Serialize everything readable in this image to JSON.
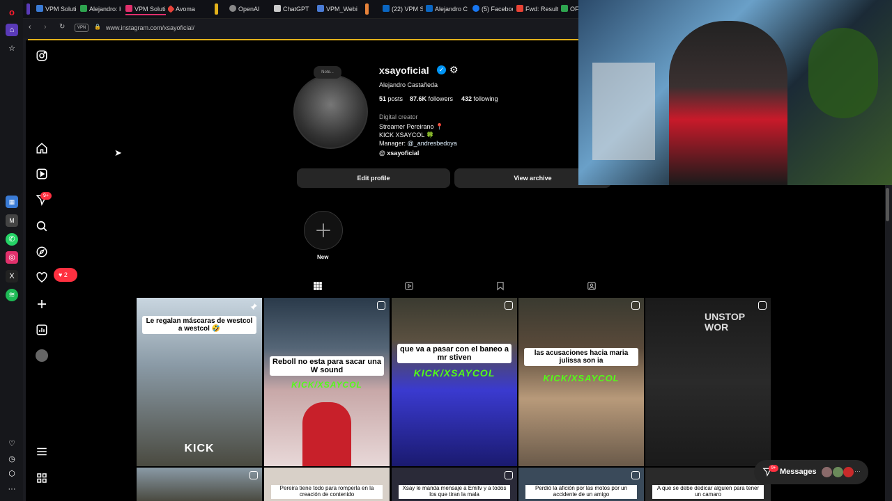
{
  "browser": {
    "tabs": [
      {
        "label": "VPM Solutio",
        "color": "#3a7bd5"
      },
      {
        "label": "Alejandro: K",
        "color": "#2ea44f"
      },
      {
        "label": "VPM Solutio",
        "color": "#e1306c"
      },
      {
        "label": "Avoma",
        "color": "#e8433a"
      },
      {
        "label": "OpenAI",
        "color": "#888888"
      },
      {
        "label": "ChatGPT",
        "color": "#cccccc"
      },
      {
        "label": "VPM_Webin",
        "color": "#4a7bd5"
      },
      {
        "label": "(22) VPM Sc",
        "color": "#0a66c2"
      },
      {
        "label": "Alejandro C",
        "color": "#0a66c2"
      },
      {
        "label": "(5) Faceboo",
        "color": "#1877f2"
      },
      {
        "label": "Fwd: Result",
        "color": "#ea4335"
      },
      {
        "label": "OF",
        "color": "#2ea44f"
      }
    ],
    "vpn_label": "VPN",
    "url": "www.instagram.com/xsayoficial/"
  },
  "rail_badge": "9+",
  "notification": {
    "count": "2"
  },
  "profile": {
    "note_label": "Note...",
    "username": "xsayoficial",
    "full_name": "Alejandro Castañeda",
    "posts_count": "51",
    "posts_label": "posts",
    "followers_count": "87.6K",
    "followers_label": "followers",
    "following_count": "432",
    "following_label": "following",
    "category": "Digital creator",
    "bio_line1": "Streamer Pereirano 📍",
    "bio_line2": "KICK XSAYCOL 🍀",
    "bio_manager_prefix": "Manager:",
    "bio_manager_handle": "@_andresbedoya",
    "threads_handle": "xsayoficial",
    "edit_profile_label": "Edit profile",
    "view_archive_label": "View archive",
    "new_highlight_label": "New"
  },
  "posts": [
    {
      "caption": "Le regalan máscaras de westcol a westcol 🤣",
      "badge": "KICK"
    },
    {
      "caption": "Reboll no esta para sacar una W sound",
      "badge": "KICK/XSAYCOL"
    },
    {
      "caption": "que va a pasar con el baneo a mr stiven",
      "badge": "KICK/XSAYCOL"
    },
    {
      "caption": "las acusaciones hacia maria julissa son ia",
      "badge": "KICK/XSAYCOL"
    },
    {
      "caption": "",
      "badge": "UNSTOP WOR"
    }
  ],
  "posts_row2": [
    {
      "caption": ""
    },
    {
      "caption": "Pereira tiene todo para romperla en la creación de contenido"
    },
    {
      "caption": "Xsay le manda mensaje a Emitv y a todos los que tiran la mala"
    },
    {
      "caption": "Perdió la afición por las motos por un accidente de un amigo"
    },
    {
      "caption": "A que se debe dedicar alguien para tener un camaro"
    }
  ],
  "messages": {
    "label": "Messages",
    "badge": "9+"
  }
}
